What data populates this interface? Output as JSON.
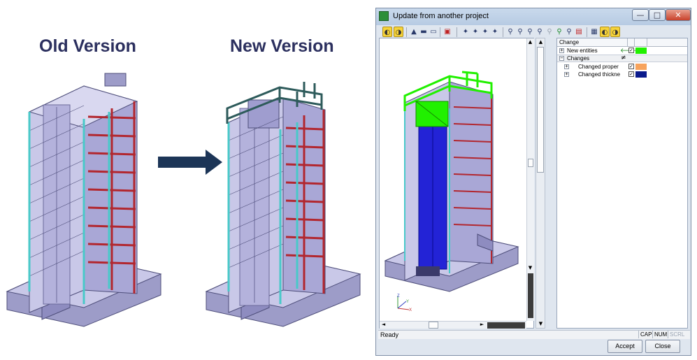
{
  "headings": {
    "old": "Old Version",
    "new": "New Version"
  },
  "colors": {
    "heading": "#2b2f5e",
    "arrow": "#1c3557",
    "building_face": "#c9c8e8",
    "building_dark": "#8e8cc0",
    "red_frame": "#b2272f",
    "cyan_column": "#49c9c9",
    "new_entity": "#21f000",
    "changed_property": "#f7a35c",
    "changed_thickness": "#0a1a8c"
  },
  "window": {
    "title": "Update from another project",
    "icon": "app-icon",
    "controls": {
      "minimize": "—",
      "maximize": "□",
      "close": "✕"
    }
  },
  "toolbar": {
    "icons": [
      "wireframe-toggle-icon",
      "shade-toggle-icon",
      "model-icon",
      "beam-icon",
      "slab-icon",
      "layers-icon",
      "selection-1-icon",
      "selection-2-icon",
      "selection-3-icon",
      "selection-4-icon",
      "zoom-icon",
      "zoom-in-icon",
      "zoom-out-icon",
      "zoom-window-icon",
      "zoom-previous-icon",
      "zoom-next-icon",
      "zoom-all-icon",
      "print-icon",
      "properties-icon",
      "filter-a-icon",
      "filter-b-icon"
    ]
  },
  "tree": {
    "column_header": "Change",
    "rows": [
      {
        "label": "New entities",
        "expander": "+",
        "mark": "🡐",
        "checked": true,
        "color": "#21f000"
      },
      {
        "label": "Changes",
        "expander": "−",
        "mark": "≠",
        "group": true
      },
      {
        "label": "Changed proper",
        "expander": "+",
        "checked": true,
        "color": "#f7a35c"
      },
      {
        "label": "Changed thickne",
        "expander": "+",
        "checked": true,
        "color": "#0a1a8c"
      }
    ]
  },
  "viewport": {
    "axes": {
      "x": "X",
      "y": "Y",
      "z": "Z"
    },
    "scroll_up": "▲",
    "scroll_down": "▼",
    "scroll_left": "◄",
    "scroll_right": "►"
  },
  "status": {
    "text": "Ready",
    "indicators": [
      "CAP",
      "NUM",
      "SCRL"
    ]
  },
  "buttons": {
    "accept": "Accept",
    "close": "Close"
  }
}
